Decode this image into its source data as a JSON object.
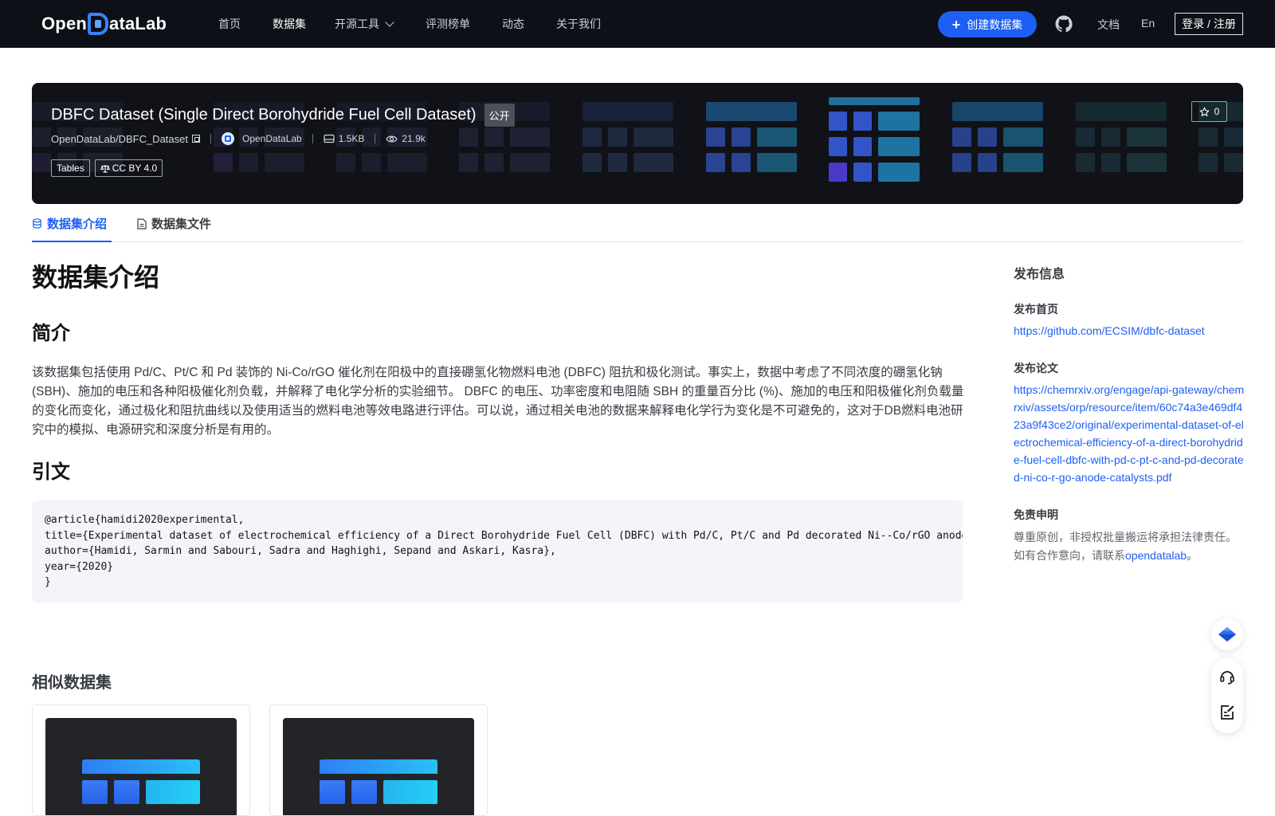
{
  "nav": {
    "logo_text_left": "Open",
    "logo_text_right": "ataLab",
    "items": [
      {
        "label": "首页"
      },
      {
        "label": "数据集"
      },
      {
        "label": "开源工具"
      },
      {
        "label": "评测榜单"
      },
      {
        "label": "动态"
      },
      {
        "label": "关于我们"
      }
    ],
    "create_label": "创建数据集",
    "docs_label": "文档",
    "lang_label": "En",
    "login_label": "登录 / 注册"
  },
  "banner": {
    "title": "DBFC Dataset (Single Direct Borohydride Fuel Cell Dataset)",
    "visibility": "公开",
    "repo_path": "OpenDataLab/DBFC_Dataset",
    "org_name": "OpenDataLab",
    "size": "1.5KB",
    "views": "21.9k",
    "tags": [
      "Tables"
    ],
    "license": "CC BY 4.0",
    "stars": "0"
  },
  "tabs": [
    {
      "label": "数据集介绍"
    },
    {
      "label": "数据集文件"
    }
  ],
  "content": {
    "page_title": "数据集介绍",
    "summary_heading": "简介",
    "summary": "该数据集包括使用 Pd/C、Pt/C 和 Pd 装饰的 Ni-Co/rGO 催化剂在阳极中的直接硼氢化物燃料电池 (DBFC) 阻抗和极化测试。事实上，数据中考虑了不同浓度的硼氢化钠 (SBH)、施加的电压和各种阳极催化剂负载，并解释了电化学分析的实验细节。 DBFC 的电压、功率密度和电阻随 SBH 的重量百分比 (%)、施加的电压和阳极催化剂负载量的变化而变化，通过极化和阻抗曲线以及使用适当的燃料电池等效电路进行评估。可以说，通过相关电池的数据来解释电化学行为变化是不可避免的，这对于DB燃料电池研究中的模拟、电源研究和深度分析是有用的。",
    "citation_heading": "引文",
    "citation_lines": [
      "@article{hamidi2020experimental,",
      "title={Experimental dataset of electrochemical efficiency of a Direct Borohydride Fuel Cell (DBFC) with Pd/C, Pt/C and Pd decorated Ni--Co/rGO anode catalysts},",
      "author={Hamidi, Sarmin and Sabouri, Sadra and Haghighi, Sepand and Askari, Kasra},",
      "year={2020}",
      "}"
    ],
    "similar_heading": "相似数据集"
  },
  "sidebar": {
    "title": "发布信息",
    "homepage_label": "发布首页",
    "homepage_url": "https://github.com/ECSIM/dbfc-dataset",
    "paper_label": "发布论文",
    "paper_url": "https://chemrxiv.org/engage/api-gateway/chemrxiv/assets/orp/resource/item/60c74a3e469df423a9f43ce2/original/experimental-dataset-of-electrochemical-efficiency-of-a-direct-borohydride-fuel-cell-dbfc-with-pd-c-pt-c-and-pd-decorated-ni-co-r-go-anode-catalysts.pdf",
    "disclaimer_label": "免责申明",
    "disclaimer_line1": "尊重原创，非授权批量搬运将承担法律责任。",
    "disclaimer_line2_prefix": "如有合作意向，请联系",
    "disclaimer_link": "opendatalab",
    "disclaimer_line2_suffix": "。"
  },
  "icons": {
    "create": "plus-icon",
    "github": "github-icon",
    "star": "star-icon",
    "storage": "storage-icon",
    "views": "eye-icon",
    "license": "scale-icon",
    "tab_intro": "database-icon",
    "tab_files": "file-icon",
    "float_top": "app-logo-icon",
    "float_support": "headset-icon",
    "float_feedback": "edit-note-icon"
  },
  "colors": {
    "nav_bg": "#0d1017",
    "accent": "#1d5ff4",
    "banner_bg": "#101217"
  }
}
